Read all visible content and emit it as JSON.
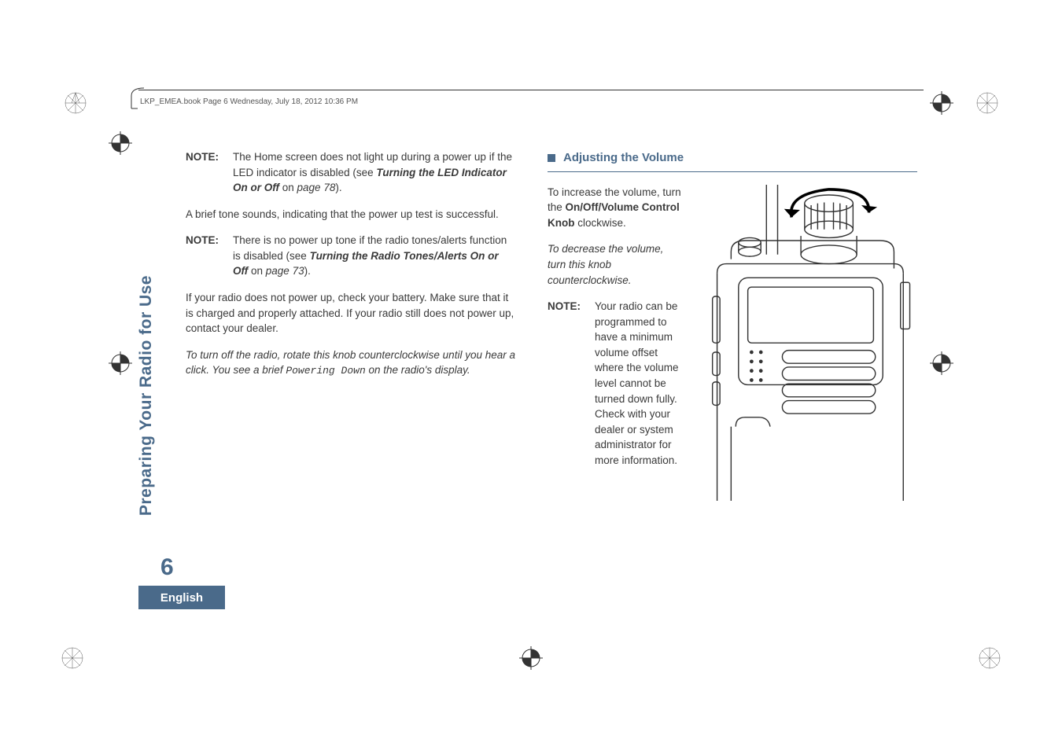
{
  "header": {
    "text": "LKP_EMEA.book  Page 6  Wednesday, July 18, 2012  10:36 PM"
  },
  "sidebar": {
    "title": "Preparing Your Radio for Use"
  },
  "page_number": "6",
  "language": "English",
  "left_column": {
    "note1_label": "NOTE:",
    "note1_text_part1": "The Home screen does not light up during a power up if the LED indicator is disabled (see ",
    "note1_link": "Turning the LED Indicator On or Off",
    "note1_text_part2": " on ",
    "note1_page": "page 78",
    "note1_text_part3": ").",
    "para1": "A brief tone sounds, indicating that the power up test is successful.",
    "note2_label": "NOTE:",
    "note2_text_part1": "There is no power up tone if the radio tones/alerts function is disabled (see ",
    "note2_link": "Turning the Radio Tones/Alerts On or Off",
    "note2_text_part2": " on ",
    "note2_page": "page 73",
    "note2_text_part3": ").",
    "para2": "If your radio does not power up, check your battery. Make sure that it is charged and properly attached. If your radio still does not power up, contact your dealer.",
    "para3_part1": "To turn off the radio, rotate this knob counterclockwise until you hear a click. You see a brief ",
    "para3_mono": "Powering Down",
    "para3_part2": " on the radio's display."
  },
  "right_column": {
    "section_title": "Adjusting the Volume",
    "para1_part1": "To increase the volume, turn the ",
    "para1_bold": "On/Off/Volume Control Knob",
    "para1_part2": " clockwise.",
    "para2": "To decrease the volume, turn this knob counterclockwise.",
    "note_label": "NOTE:",
    "note_text": "Your radio can be programmed to have a minimum volume offset where the volume level cannot be turned down fully. Check with your dealer or system administrator for more information."
  }
}
